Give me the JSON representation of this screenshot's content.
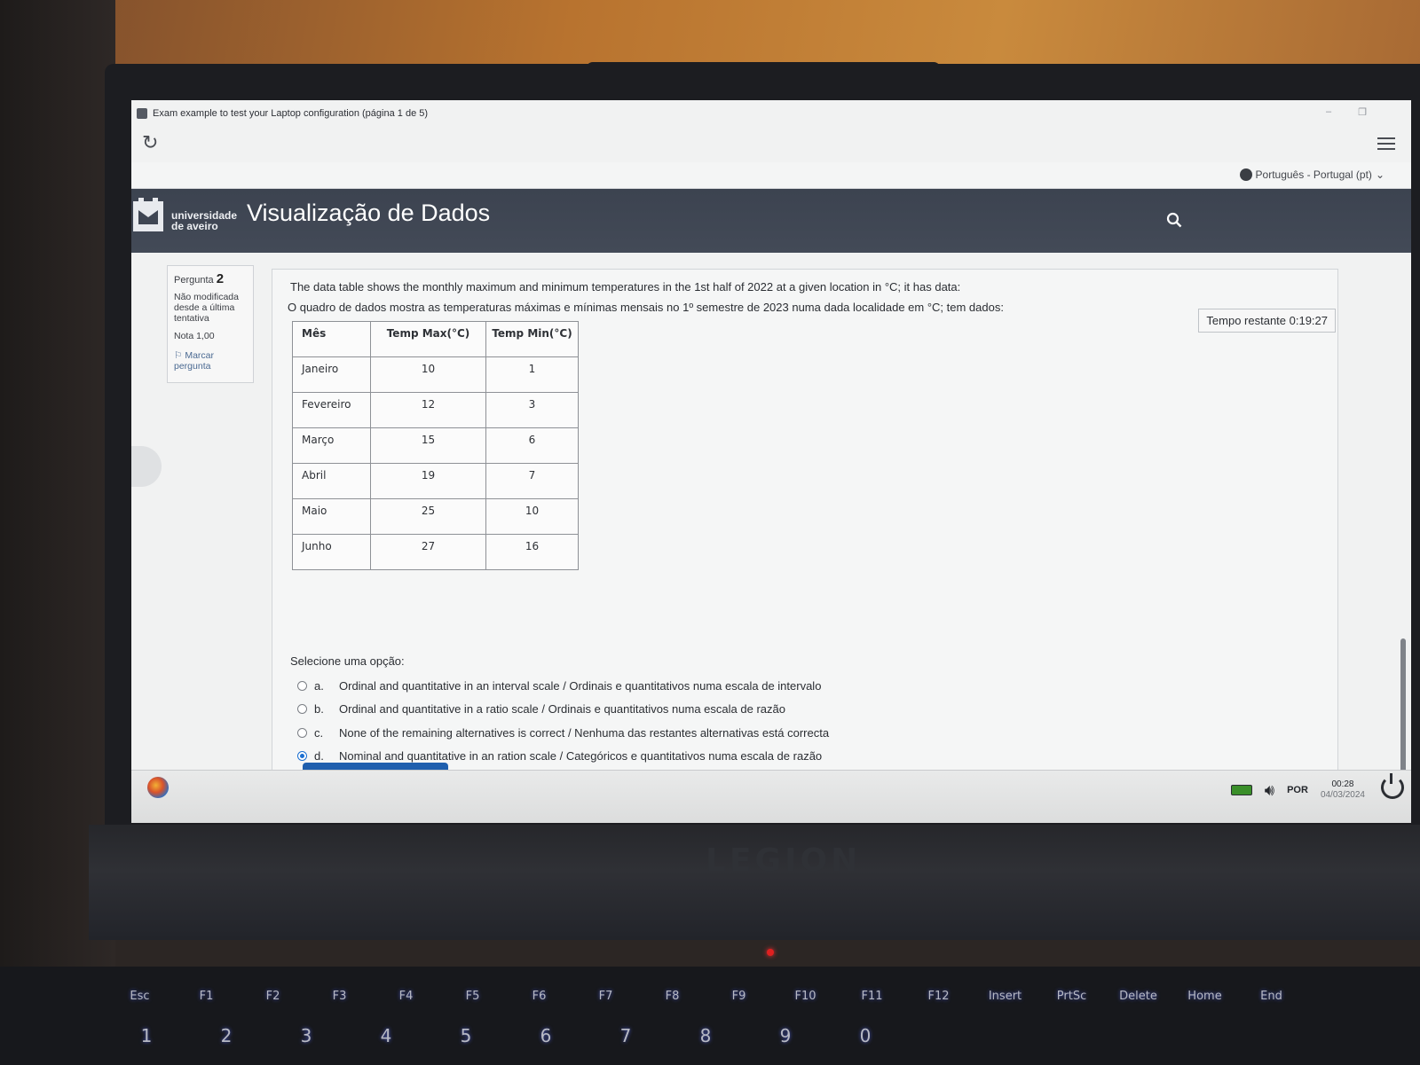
{
  "window": {
    "title": "Exam example to test your Laptop configuration (página 1 de 5)",
    "min": "–",
    "restore": "❐"
  },
  "langbar": {
    "language": "Português - Portugal (pt)"
  },
  "header": {
    "logo_line1": "universidade",
    "logo_line2": "de aveiro",
    "course_title": "Visualização de Dados"
  },
  "question_info": {
    "label": "Pergunta",
    "number": "2",
    "state": "Não modificada desde a última tentativa",
    "grade": "Nota 1,00",
    "flag": "Marcar pergunta"
  },
  "timer": "Tempo restante 0:19:27",
  "question": {
    "text_en": "The data table shows the monthly maximum and minimum temperatures in the 1st half of 2022 at a given location in °C; it has data:",
    "text_pt": "O quadro de dados mostra as temperaturas máximas e mínimas mensais no 1º semestre de 2023 numa dada localidade em °C; tem dados:",
    "table": {
      "headers": [
        "Mês",
        "Temp Max(°C)",
        "Temp Min(°C)"
      ],
      "rows": [
        [
          "Janeiro",
          "10",
          "1"
        ],
        [
          "Fevereiro",
          "12",
          "3"
        ],
        [
          "Março",
          "15",
          "6"
        ],
        [
          "Abril",
          "19",
          "7"
        ],
        [
          "Maio",
          "25",
          "10"
        ],
        [
          "Junho",
          "27",
          "16"
        ]
      ]
    },
    "prompt": "Selecione uma opção:",
    "options": [
      {
        "letter": "a.",
        "text": "Ordinal and quantitative in an interval scale / Ordinais e quantitativos numa escala de intervalo",
        "selected": false
      },
      {
        "letter": "b.",
        "text": "Ordinal and quantitative in a ratio scale / Ordinais e quantitativos numa escala de razão",
        "selected": false
      },
      {
        "letter": "c.",
        "text": "None of the remaining alternatives is correct / Nenhuma das restantes alternativas está correcta",
        "selected": false
      },
      {
        "letter": "d.",
        "text": "Nominal and quantitative in an ration scale / Categóricos e quantitativos numa escala de razão",
        "selected": true
      }
    ]
  },
  "taskbar": {
    "lang": "POR",
    "time": "00:28",
    "date": "04/03/2024"
  },
  "laptop": {
    "brand": "LEGION",
    "fn_keys": [
      "Esc",
      "F1",
      "F2",
      "F3",
      "F4",
      "F5",
      "F6",
      "F7",
      "F8",
      "F9",
      "F10",
      "F11",
      "F12",
      "Insert",
      "PrtSc",
      "Delete",
      "Home",
      "End"
    ],
    "num_keys": [
      "1",
      "2",
      "3",
      "4",
      "5",
      "6",
      "7",
      "8",
      "9",
      "0"
    ]
  }
}
